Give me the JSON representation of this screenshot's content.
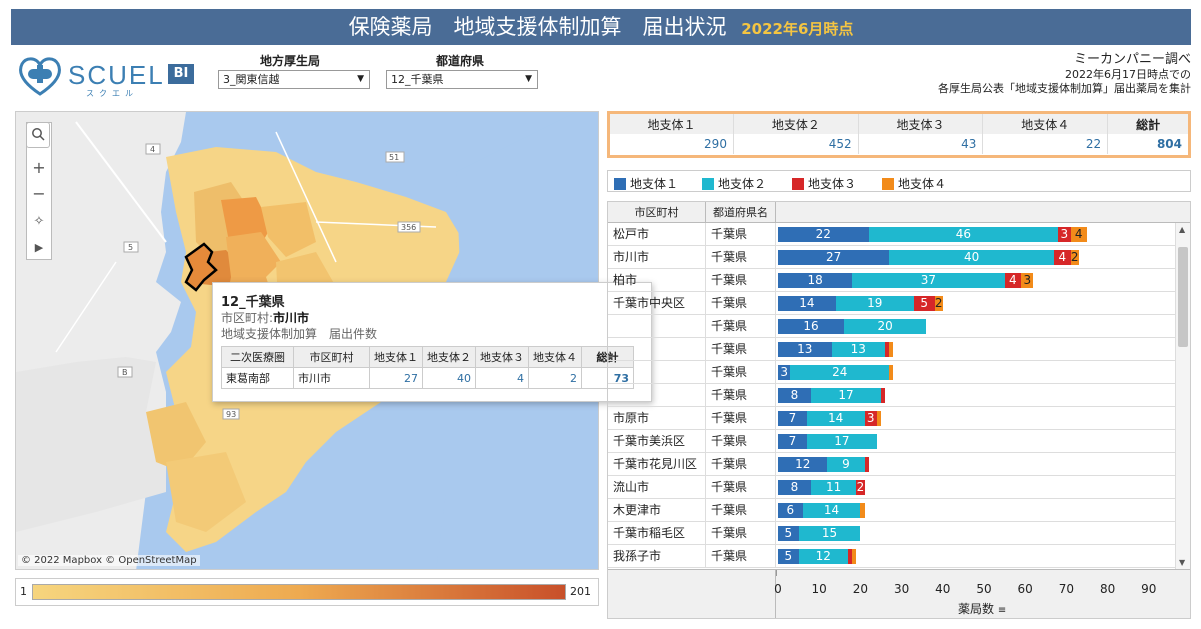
{
  "header": {
    "title": "保険薬局　地域支援体制加算　届出状況",
    "date": "2022年6月時点"
  },
  "logo": {
    "text": "SCUEL",
    "bi": "BI",
    "sub": "スクエル"
  },
  "filters": {
    "bureau_label": "地方厚生局",
    "bureau_value": "3_関東信越",
    "pref_label": "都道府県",
    "pref_value": "12_千葉県"
  },
  "credit": {
    "line1": "ミーカンパニー調べ",
    "line2": "2022年6月17日時点での",
    "line3": "各厚生局公表「地域支援体制加算」届出薬局を集計"
  },
  "map": {
    "attribution": "© 2022 Mapbox © OpenStreetMap",
    "road_labels": [
      "4",
      "51",
      "356",
      "5",
      "B",
      "93"
    ]
  },
  "legend": {
    "min": "1",
    "max": "201"
  },
  "tooltip": {
    "pref": "12_千葉県",
    "city_label": "市区町村:",
    "city": "市川市",
    "metric": "地域支援体制加算　届出件数",
    "headers": [
      "二次医療圏",
      "市区町村",
      "地支体１",
      "地支体２",
      "地支体３",
      "地支体４",
      "総計"
    ],
    "row": [
      "東葛南部",
      "市川市",
      "27",
      "40",
      "4",
      "2",
      "73"
    ]
  },
  "summary": {
    "headers": [
      "地支体１",
      "地支体２",
      "地支体３",
      "地支体４",
      "総計"
    ],
    "values": [
      "290",
      "452",
      "43",
      "22",
      "804"
    ]
  },
  "series_legend": [
    "地支体１",
    "地支体２",
    "地支体３",
    "地支体４"
  ],
  "colors": {
    "s1": "#2f6eb5",
    "s2": "#1fb8cf",
    "s3": "#d62728",
    "s4": "#f28b1a",
    "title": "#4a6c96"
  },
  "table_headers": {
    "city": "市区町村",
    "pref": "都道府県名"
  },
  "chart_data": {
    "type": "bar",
    "orientation": "horizontal",
    "stacked": true,
    "xlabel": "薬局数",
    "xlim": [
      0,
      93
    ],
    "ticks": [
      "0",
      "10",
      "20",
      "30",
      "40",
      "50",
      "60",
      "70",
      "80",
      "90"
    ],
    "series_names": [
      "地支体１",
      "地支体２",
      "地支体３",
      "地支体４"
    ],
    "rows": [
      {
        "city": "松戸市",
        "pref": "千葉県",
        "values": [
          22,
          46,
          3,
          4
        ]
      },
      {
        "city": "市川市",
        "pref": "千葉県",
        "values": [
          27,
          40,
          4,
          2
        ]
      },
      {
        "city": "柏市",
        "pref": "千葉県",
        "values": [
          18,
          37,
          4,
          3
        ]
      },
      {
        "city": "千葉市中央区",
        "pref": "千葉県",
        "values": [
          14,
          19,
          5,
          2
        ]
      },
      {
        "city": "",
        "pref": "千葉県",
        "values": [
          16,
          20,
          0,
          0
        ]
      },
      {
        "city": "",
        "pref": "千葉県",
        "values": [
          13,
          13,
          1,
          1
        ]
      },
      {
        "city": "",
        "pref": "千葉県",
        "values": [
          3,
          24,
          0,
          1
        ]
      },
      {
        "city": "",
        "pref": "千葉県",
        "values": [
          8,
          17,
          1,
          0
        ]
      },
      {
        "city": "市原市",
        "pref": "千葉県",
        "values": [
          7,
          14,
          3,
          1
        ]
      },
      {
        "city": "千葉市美浜区",
        "pref": "千葉県",
        "values": [
          7,
          17,
          0,
          0
        ]
      },
      {
        "city": "千葉市花見川区",
        "pref": "千葉県",
        "values": [
          12,
          9,
          1,
          0
        ]
      },
      {
        "city": "流山市",
        "pref": "千葉県",
        "values": [
          8,
          11,
          2,
          0
        ]
      },
      {
        "city": "木更津市",
        "pref": "千葉県",
        "values": [
          6,
          14,
          0,
          1
        ]
      },
      {
        "city": "千葉市稲毛区",
        "pref": "千葉県",
        "values": [
          5,
          15,
          0,
          0
        ]
      },
      {
        "city": "我孫子市",
        "pref": "千葉県",
        "values": [
          5,
          12,
          1,
          1
        ]
      }
    ]
  }
}
